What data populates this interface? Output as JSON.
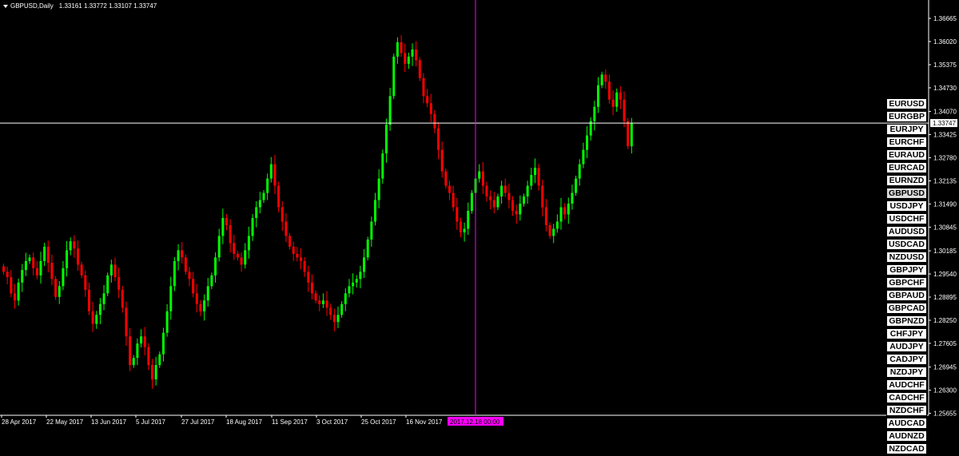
{
  "header": {
    "symbol_tf": "GBPUSD,Daily",
    "ohlc": "1.33161 1.33772 1.33107 1.33747"
  },
  "colors": {
    "background": "#000000",
    "bull": "#00ff00",
    "bear": "#ff0000",
    "crosshair_h": "#ffffff",
    "crosshair_v": "#ff00ff",
    "price_tag_bg": "#ffffff",
    "date_tag_bg": "#ff00ff"
  },
  "chart_data": {
    "type": "candlestick",
    "symbol": "GBPUSD",
    "timeframe": "Daily",
    "ylim": [
      1.256,
      1.37
    ],
    "price_ticks": [
      "1.36665",
      "1.36020",
      "1.35375",
      "1.34730",
      "1.34070",
      "1.33425",
      "1.32780",
      "1.32135",
      "1.31490",
      "1.30845",
      "1.30185",
      "1.29540",
      "1.28895",
      "1.28250",
      "1.27605",
      "1.26945",
      "1.26300",
      "1.25655"
    ],
    "date_ticks": [
      "28 Apr 2017",
      "22 May 2017",
      "13 Jun 2017",
      "5 Jul 2017",
      "27 Jul 2017",
      "18 Aug 2017",
      "11 Sep 2017",
      "3 Oct 2017",
      "25 Oct 2017",
      "16 Nov 2017"
    ],
    "crosshair_price": "1.33747",
    "crosshair_date": "2017.12.18 00:00",
    "closes": [
      1.296,
      1.2945,
      1.29,
      1.288,
      1.293,
      1.2965,
      1.299,
      1.3,
      1.297,
      1.295,
      1.299,
      1.303,
      1.2985,
      1.294,
      1.289,
      1.292,
      1.297,
      1.302,
      1.3045,
      1.3025,
      1.298,
      1.295,
      1.291,
      1.285,
      1.2815,
      1.284,
      1.287,
      1.29,
      1.295,
      1.298,
      1.2945,
      1.291,
      1.286,
      1.278,
      1.27,
      1.272,
      1.276,
      1.278,
      1.275,
      1.27,
      1.266,
      1.27,
      1.273,
      1.279,
      1.285,
      1.292,
      1.299,
      1.302,
      1.3,
      1.296,
      1.294,
      1.29,
      1.287,
      1.285,
      1.288,
      1.292,
      1.295,
      1.3,
      1.306,
      1.311,
      1.309,
      1.304,
      1.301,
      1.3,
      1.298,
      1.302,
      1.306,
      1.311,
      1.314,
      1.316,
      1.318,
      1.322,
      1.326,
      1.32,
      1.314,
      1.31,
      1.306,
      1.303,
      1.301,
      1.3,
      1.299,
      1.296,
      1.293,
      1.29,
      1.288,
      1.287,
      1.288,
      1.286,
      1.284,
      1.282,
      1.284,
      1.287,
      1.29,
      1.292,
      1.293,
      1.294,
      1.296,
      1.3,
      1.305,
      1.31,
      1.316,
      1.322,
      1.329,
      1.337,
      1.345,
      1.356,
      1.36,
      1.357,
      1.354,
      1.356,
      1.358,
      1.355,
      1.35,
      1.345,
      1.343,
      1.34,
      1.336,
      1.33,
      1.324,
      1.32,
      1.318,
      1.314,
      1.31,
      1.307,
      1.308,
      1.313,
      1.318,
      1.322,
      1.324,
      1.32,
      1.317,
      1.316,
      1.314,
      1.317,
      1.32,
      1.318,
      1.316,
      1.313,
      1.312,
      1.315,
      1.317,
      1.32,
      1.323,
      1.325,
      1.32,
      1.314,
      1.309,
      1.306,
      1.308,
      1.31,
      1.314,
      1.312,
      1.315,
      1.318,
      1.322,
      1.326,
      1.33,
      1.334,
      1.338,
      1.342,
      1.348,
      1.351,
      1.349,
      1.344,
      1.342,
      1.346,
      1.344,
      1.338,
      1.331,
      1.3375
    ]
  },
  "symbols": [
    {
      "label": "EURUSD"
    },
    {
      "label": "EURGBP"
    },
    {
      "label": "EURJPY"
    },
    {
      "label": "EURCHF"
    },
    {
      "label": "EURAUD"
    },
    {
      "label": "EURCAD"
    },
    {
      "label": "EURNZD"
    },
    {
      "label": "GBPUSD",
      "current": true
    },
    {
      "label": "USDJPY"
    },
    {
      "label": "USDCHF"
    },
    {
      "label": "AUDUSD"
    },
    {
      "label": "USDCAD"
    },
    {
      "label": "NZDUSD"
    },
    {
      "label": "GBPJPY"
    },
    {
      "label": "GBPCHF"
    },
    {
      "label": "GBPAUD"
    },
    {
      "label": "GBPCAD"
    },
    {
      "label": "GBPNZD"
    },
    {
      "label": "CHFJPY"
    },
    {
      "label": "AUDJPY"
    },
    {
      "label": "CADJPY"
    },
    {
      "label": "NZDJPY"
    },
    {
      "label": "AUDCHF"
    },
    {
      "label": "CADCHF"
    },
    {
      "label": "NZDCHF"
    },
    {
      "label": "AUDCAD"
    },
    {
      "label": "AUDNZD"
    },
    {
      "label": "NZDCAD"
    }
  ]
}
